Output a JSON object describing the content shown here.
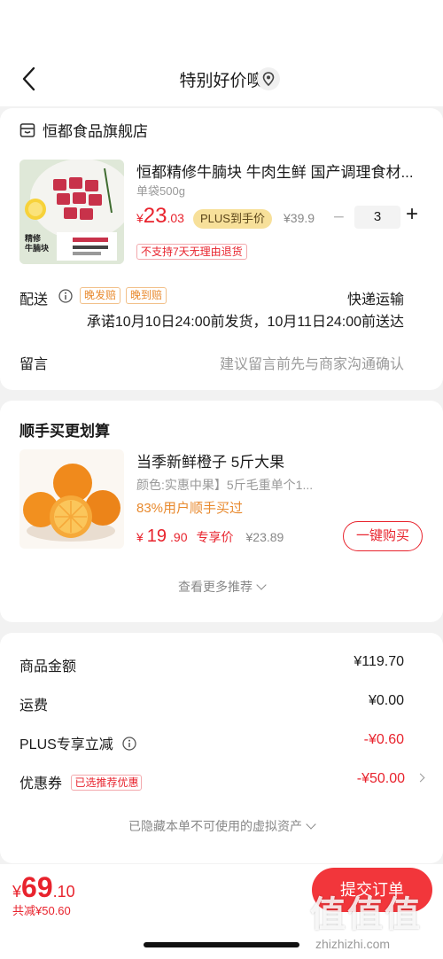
{
  "header": {
    "title": "特别好价噢"
  },
  "store": {
    "name": "恒都食品旗舰店"
  },
  "product": {
    "name": "恒都精修牛腩块 牛肉生鲜 国产调理食材...",
    "spec": "单袋500g",
    "price_yen": "¥",
    "price_int": "23",
    "price_dec": ".03",
    "plus_tag": "PLUS到手价",
    "original_price": "¥39.9",
    "quantity": "3",
    "qty_minus": "−",
    "qty_plus": "+",
    "return_notice": "不支持7天无理由退货",
    "image_caption_1": "精修",
    "image_caption_2": "牛腩块"
  },
  "delivery": {
    "label": "配送",
    "tag_late_ship": "晚发赔",
    "tag_late_arrive": "晚到赔",
    "method": "快递运输",
    "promise": "承诺10月10日24:00前发货，10月11日24:00前送达"
  },
  "message": {
    "label": "留言",
    "placeholder": "建议留言前先与商家沟通确认"
  },
  "recommend": {
    "title": "顺手买更划算",
    "name": "当季新鲜橙子 5斤大果",
    "spec": "颜色:实惠中果】5斤毛重单个1...",
    "buy_rate": "83%用户顺手买过",
    "price_yen": "¥",
    "price_int": "19",
    "price_dec": ".90",
    "price_label": "专享价",
    "original_price": "¥23.89",
    "buy_button": "一键购买",
    "more": "查看更多推荐"
  },
  "summary": {
    "goods_label": "商品金额",
    "goods_value": "¥119.70",
    "shipping_label": "运费",
    "shipping_value": "¥0.00",
    "plus_label": "PLUS专享立减",
    "plus_value": "-¥0.60",
    "coupon_label": "优惠券",
    "coupon_tag": "已选推荐优惠",
    "coupon_value": "-¥50.00",
    "hidden_assets": "已隐藏本单不可使用的虚拟资产"
  },
  "footer": {
    "total_yen": "¥",
    "total_int": "69",
    "total_dec": ".10",
    "saved": "共减¥50.60",
    "submit": "提交订单",
    "watermark": "值值值",
    "watermark_url": "zhizhizhi.com"
  },
  "colors": {
    "accent": "#e8232d",
    "plus_gold": "#f7e09a",
    "orange_tag": "#e8892d"
  }
}
